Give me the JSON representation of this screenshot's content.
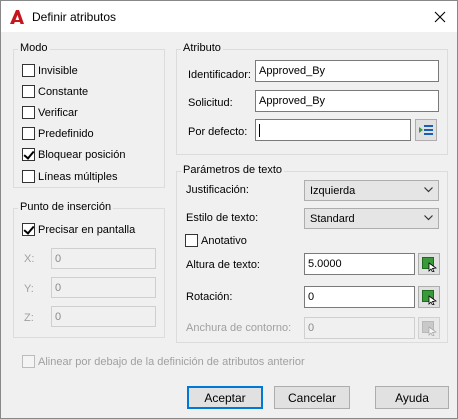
{
  "window": {
    "title": "Definir atributos",
    "close_glyph": "✕",
    "app_icon": "autocad-logo-icon"
  },
  "modo": {
    "legend": "Modo",
    "options": [
      {
        "label": "Invisible",
        "checked": false
      },
      {
        "label": "Constante",
        "checked": false
      },
      {
        "label": "Verificar",
        "checked": false
      },
      {
        "label": "Predefinido",
        "checked": false
      },
      {
        "label": "Bloquear posición",
        "checked": true
      },
      {
        "label": "Líneas múltiples",
        "checked": false
      }
    ]
  },
  "insercion": {
    "legend": "Punto de inserción",
    "on_screen_label": "Precisar en pantalla",
    "on_screen_checked": true,
    "x_label": "X:",
    "x_value": "0",
    "y_label": "Y:",
    "y_value": "0",
    "z_label": "Z:",
    "z_value": "0"
  },
  "atributo": {
    "legend": "Atributo",
    "identificador_label": "Identificador:",
    "identificador_value": "Approved_By",
    "solicitud_label": "Solicitud:",
    "solicitud_value": "Approved_By",
    "defecto_label": "Por defecto:",
    "defecto_value": ""
  },
  "texto": {
    "legend": "Parámetros de texto",
    "justificacion_label": "Justificación:",
    "justificacion_value": "Izquierda",
    "estilo_label": "Estilo de texto:",
    "estilo_value": "Standard",
    "anotativo_label": "Anotativo",
    "anotativo_checked": false,
    "altura_label": "Altura de texto:",
    "altura_value": "5.0000",
    "rotacion_label": "Rotación:",
    "rotacion_value": "0",
    "anchura_label": "Anchura de contorno:",
    "anchura_value": "0"
  },
  "alinear": {
    "label": "Alinear por debajo de la definición de atributos anterior",
    "checked": false
  },
  "buttons": {
    "accept": "Aceptar",
    "cancel": "Cancelar",
    "help": "Ayuda"
  },
  "colors": {
    "accent": "#0078d7",
    "logo_red": "#c4161c",
    "picker_green": "#3a9a3a"
  }
}
